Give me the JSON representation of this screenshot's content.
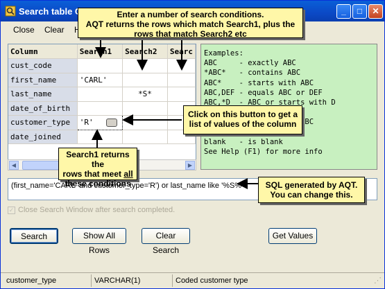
{
  "window": {
    "title": "Search table C"
  },
  "menu": {
    "close": "Close",
    "clear": "Clear",
    "help": "H"
  },
  "grid": {
    "headers": [
      "Column",
      "Search1",
      "Search2",
      "Searc"
    ],
    "rows": [
      {
        "column": "cust_code",
        "search1": "",
        "search2": ""
      },
      {
        "column": "first_name",
        "search1": "'CARL'",
        "search2": ""
      },
      {
        "column": "last_name",
        "search1": "",
        "search2": "*S*"
      },
      {
        "column": "date_of_birth",
        "search1": "",
        "search2": ""
      },
      {
        "column": "customer_type",
        "search1": "'R'",
        "search2": ""
      },
      {
        "column": "date_joined",
        "search1": "",
        "search2": ""
      }
    ]
  },
  "examples": {
    "lines": [
      "Examples:",
      "ABC     - exactly ABC",
      "*ABC*   - contains ABC",
      "ABC*    - starts with ABC",
      "ABC,DEF - equals ABC or DEF",
      "ABC,*D  - ABC or starts with D",
      "                nd D",
      "                ntain ABC",
      "",
      "blank   - is blank",
      "See Help (F1) for more info"
    ]
  },
  "sql": {
    "text": "(first_name='CARL' and customer_type='R') or last_name like '%S%'"
  },
  "checkbox": {
    "label": "Close Search Window after search completed.",
    "checked": true
  },
  "buttons": {
    "search": "Search",
    "show_all": "Show All Rows",
    "clear_search": "Clear Search",
    "get_values": "Get Values"
  },
  "status": {
    "column": "customer_type",
    "type": "VARCHAR(1)",
    "description": "Coded customer type"
  },
  "callouts": {
    "top_line1": "Enter a number of search conditions.",
    "top_line2": "AQT returns the rows which match Search1, plus the",
    "top_line3": "rows that match Search2 etc",
    "button_line1": "Click on this button to get a",
    "button_line2": "list of values of the column",
    "search1_line1": "Search1 returns the",
    "search1_line2a": "rows that meet ",
    "search1_line2b": "all",
    "search1_line3": "these conditions",
    "sql_line1": "SQL generated by AQT.",
    "sql_line2": "You can change this."
  },
  "colors": {
    "callout": "#fff7a8",
    "examples_bg": "#c8f0c0",
    "titlebar": "#0b49c6"
  }
}
